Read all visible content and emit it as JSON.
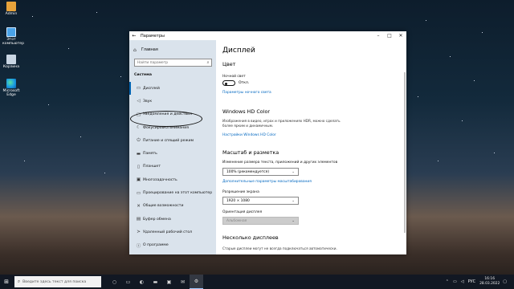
{
  "desktop": {
    "icons": [
      {
        "label": "Admin",
        "icon": "user-folder-icon"
      },
      {
        "label": "Этот компьютер",
        "icon": "this-pc-icon"
      },
      {
        "label": "Корзина",
        "icon": "recycle-bin-icon"
      },
      {
        "label": "Microsoft Edge",
        "icon": "edge-icon"
      }
    ]
  },
  "window": {
    "title": "Параметры",
    "sidebar": {
      "home_label": "Главная",
      "search_placeholder": "Найти параметр",
      "section_title": "Система",
      "items": [
        {
          "label": "Дисплей",
          "icon": "monitor-icon",
          "active": true
        },
        {
          "label": "Звук",
          "icon": "speaker-icon"
        },
        {
          "label": "Уведомления и действия",
          "icon": "notifications-icon"
        },
        {
          "label": "Фокусировка внимания",
          "icon": "focus-assist-icon"
        },
        {
          "label": "Питание и спящий режим",
          "icon": "power-icon"
        },
        {
          "label": "Память",
          "icon": "storage-icon"
        },
        {
          "label": "Планшет",
          "icon": "tablet-icon"
        },
        {
          "label": "Многозадачность",
          "icon": "multitasking-icon"
        },
        {
          "label": "Проецирование на этот компьютер",
          "icon": "projecting-icon"
        },
        {
          "label": "Общие возможности",
          "icon": "shared-experiences-icon"
        },
        {
          "label": "Буфер обмена",
          "icon": "clipboard-icon"
        },
        {
          "label": "Удаленный рабочий стол",
          "icon": "remote-desktop-icon"
        },
        {
          "label": "О программе",
          "icon": "about-icon"
        }
      ]
    },
    "content": {
      "title": "Дисплей",
      "color_section": "Цвет",
      "night_light_label": "Ночной свет",
      "night_light_state": "Откл.",
      "night_light_link": "Параметры ночного света",
      "hdr_section": "Windows HD Color",
      "hdr_desc": "Изображения в видео, играх и приложениях HDR, можно сделать более ярким и динамичным.",
      "hdr_link": "Настройки Windows HD Color",
      "scale_section": "Масштаб и разметка",
      "scale_label": "Изменение размера текста, приложений и других элементов",
      "scale_value": "100% (рекомендуется)",
      "scale_link": "Дополнительные параметры масштабирования",
      "resolution_label": "Разрешение экрана",
      "resolution_value": "1920 × 1080",
      "orientation_label": "Ориентация дисплея",
      "orientation_value": "Альбомная",
      "multi_section": "Несколько дисплеев",
      "multi_desc": "Старые дисплеи могут не всегда подключаться автоматически."
    }
  },
  "taskbar": {
    "search_placeholder": "Введите здесь текст для поиска",
    "language": "РУС",
    "time": "16:16",
    "date": "28.03.2022"
  }
}
